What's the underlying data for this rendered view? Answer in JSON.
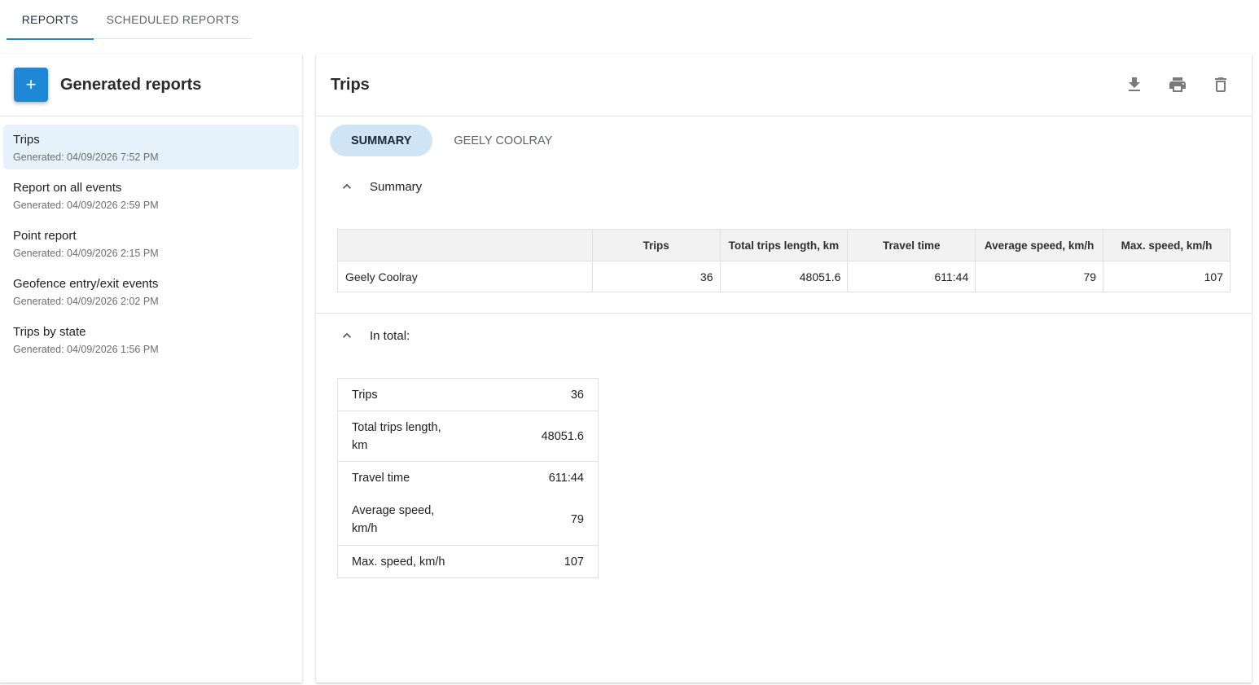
{
  "top_tabs": [
    {
      "label": "REPORTS"
    },
    {
      "label": "SCHEDULED REPORTS"
    }
  ],
  "sidebar": {
    "add_button": "+",
    "title": "Generated reports",
    "items": [
      {
        "name": "Trips",
        "date": "Generated: 04/09/2026 7:52 PM"
      },
      {
        "name": "Report on all events",
        "date": "Generated: 04/09/2026 2:59 PM"
      },
      {
        "name": "Point report",
        "date": "Generated: 04/09/2026 2:15 PM"
      },
      {
        "name": "Geofence entry/exit events",
        "date": "Generated: 04/09/2026 2:02 PM"
      },
      {
        "name": "Trips by state",
        "date": "Generated: 04/09/2026 1:56 PM"
      }
    ]
  },
  "main": {
    "title": "Trips",
    "icons": [
      "download-icon",
      "print-icon",
      "delete-icon"
    ],
    "tabs": [
      {
        "label": "SUMMARY"
      },
      {
        "label": "GEELY COOLRAY"
      }
    ],
    "summary_section": "Summary",
    "summary_table": {
      "headers": [
        "",
        "Trips",
        "Total trips length, km",
        "Travel time",
        "Average speed, km/h",
        "Max. speed, km/h"
      ],
      "rows": [
        [
          "Geely Coolray",
          "36",
          "48051.6",
          "611:44",
          "79",
          "107"
        ]
      ]
    },
    "totals_section": "In total:",
    "totals": [
      {
        "label": "Trips",
        "value": "36"
      },
      {
        "label": "Total trips length, km",
        "value": "48051.6"
      },
      {
        "label": "Travel time",
        "value": "611:44"
      },
      {
        "label": "Average speed, km/h",
        "value": "79"
      },
      {
        "label": "Max. speed, km/h",
        "value": "107"
      }
    ]
  },
  "colors": {
    "accent": "#1e88d6",
    "selected_bg": "#e6f2fb",
    "active_tab_bg": "#cfe5f6"
  }
}
